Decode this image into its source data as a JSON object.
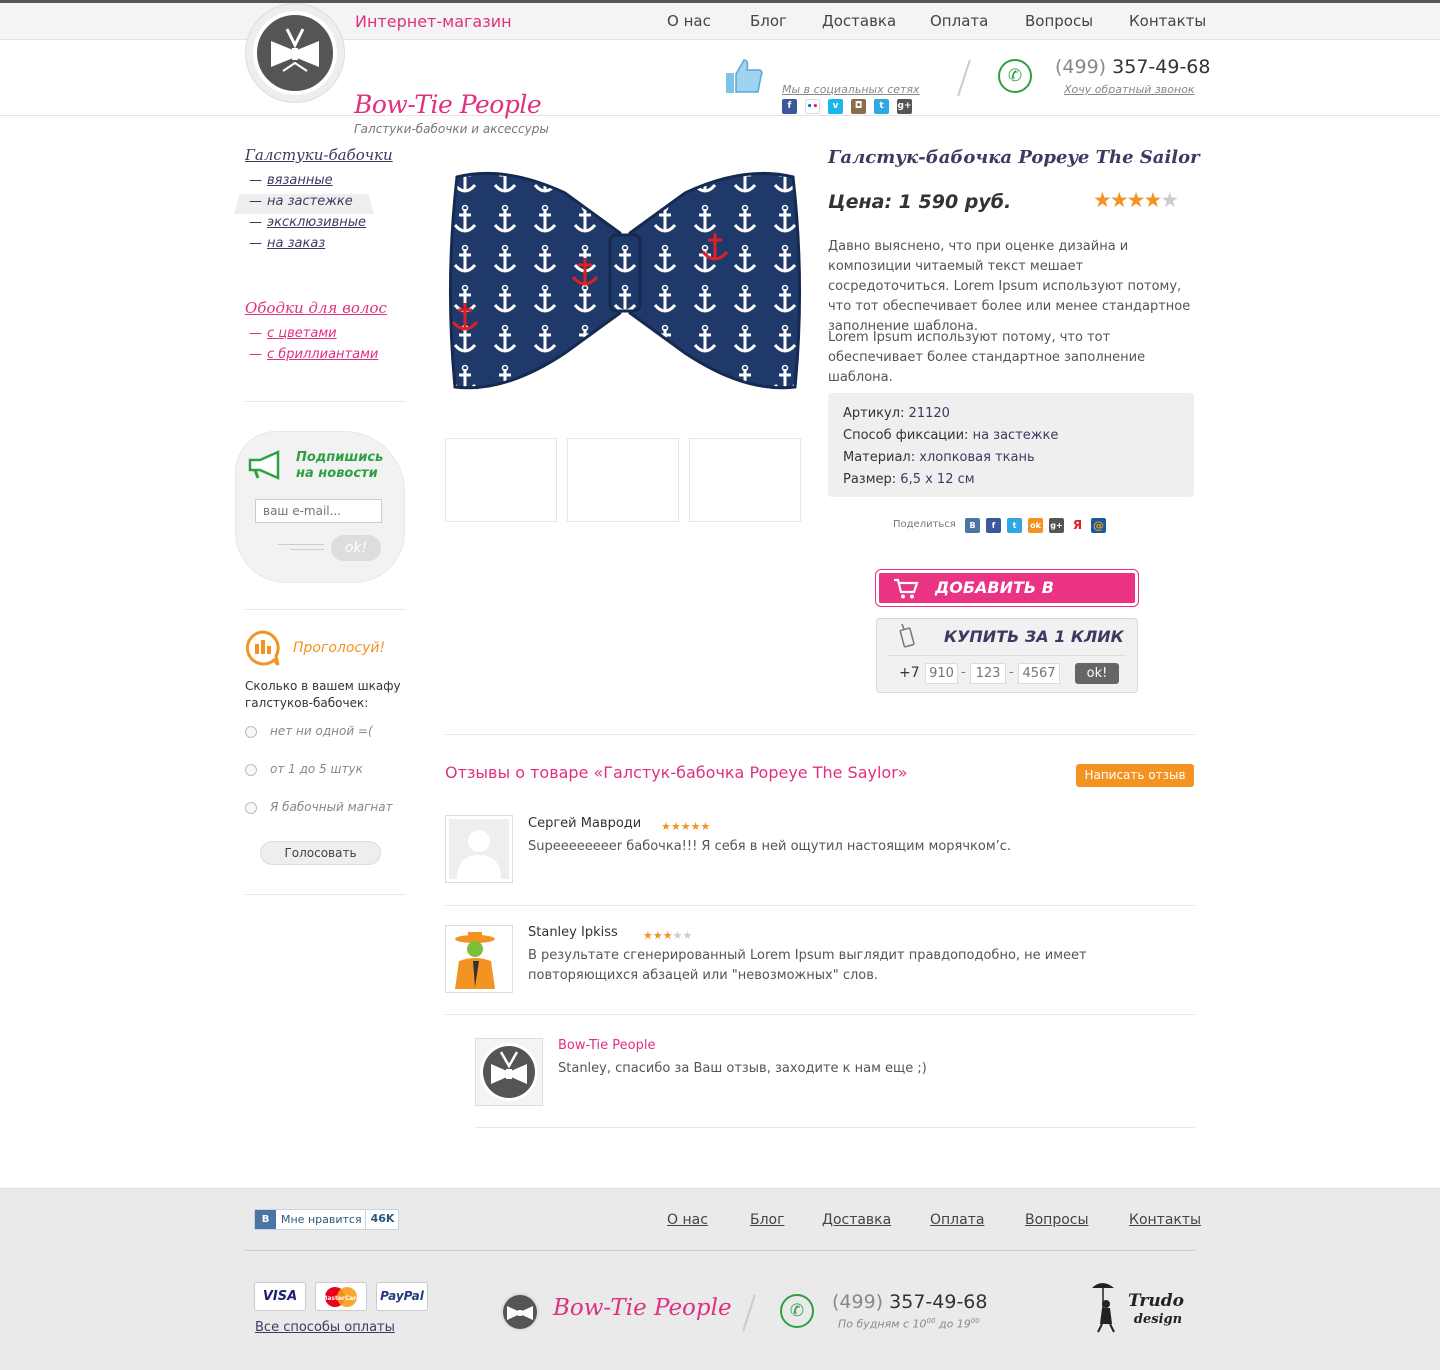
{
  "header": {
    "shop_label": "Интернет-магазин",
    "nav": [
      "О нас",
      "Блог",
      "Доставка",
      "Оплата",
      "Вопросы",
      "Контакты"
    ],
    "brand": "Bow-Tie People",
    "tagline": "Галстуки-бабочки и аксессуры",
    "social_caption": "Мы в социальных сетях",
    "social_icons": [
      "facebook-icon",
      "flickr-icon",
      "vimeo-icon",
      "instagram-icon",
      "twitter-icon",
      "googleplus-icon"
    ],
    "phone_code": "(499)",
    "phone_number": "357-49-68",
    "callback": "Хочу обратный звонок"
  },
  "sidebar": {
    "cat1_title": "Галстуки-бабочки",
    "cat1_items": [
      "вязанные",
      "на застежке",
      "эксклюзивные",
      "на заказ"
    ],
    "cat2_title": "Ободки для волос",
    "cat2_items": [
      "с цветами",
      "с бриллиантами"
    ],
    "subscribe_title_1": "Подпишись",
    "subscribe_title_2": "на новости",
    "email_placeholder": "ваш e-mail...",
    "subscribe_button": "ok!",
    "poll_title": "Проголосуй!",
    "poll_question": "Сколько в вашем шкафу галстуков-бабочек:",
    "poll_options": [
      "нет ни одной =(",
      "от 1 до 5 штук",
      "Я бабочный магнат"
    ],
    "vote_button": "Голосовать"
  },
  "product": {
    "title": "Галстук-бабочка Popeye The Sailor",
    "price": "Цена: 1 590 руб.",
    "rating": 4,
    "desc1": "Давно выяснено, что при оценке дизайна и композиции читаемый текст мешает сосредоточиться. Lorem Ipsum используют потому, что тот обеспечивает более или менее стандартное заполнение шаблона.",
    "desc2": "Lorem Ipsum используют потому, что тот обеспечивает более стандартное заполнение шаблона.",
    "specs": [
      {
        "label": "Артикул:",
        "value": "21120"
      },
      {
        "label": "Способ фиксации:",
        "value": "на застежке"
      },
      {
        "label": "Материал:",
        "value": "хлопковая ткань"
      },
      {
        "label": "Размер:",
        "value": "6,5 х 12 см"
      }
    ],
    "share_label": "Поделиться",
    "share_icons": [
      "vk-icon",
      "facebook-icon",
      "twitter-icon",
      "odnoklassniki-icon",
      "googleplus-icon",
      "ya-icon",
      "mail-icon"
    ],
    "cart_button": "ДОБАВИТЬ В КОРЗИНУ",
    "oneclick_title": "КУПИТЬ ЗА 1 КЛИК",
    "phone_prefix": "+7",
    "phone_ph1": "910",
    "phone_ph2": "123",
    "phone_ph3": "4567",
    "oneclick_button": "ok!"
  },
  "reviews": {
    "title": "Отзывы о товаре «Галстук-бабочка Popeye The Saylor»",
    "write_button": "Написать отзыв",
    "items": [
      {
        "name": "Сергей Мавроди",
        "rating": 5,
        "text": "Supeeeeeeeer бабочка!!! Я себя в ней ощутил настоящим морячком’с."
      },
      {
        "name": "Stanley Ipkiss",
        "rating": 3,
        "text": "В результате сгенерированный Lorem Ipsum выглядит правдоподобно, не имеет повторяющихся абзацей или \"невозможных\" слов."
      }
    ],
    "reply": {
      "name": "Bow-Tie People",
      "text": "Stanley, спасибо за Ваш отзыв, заходите к нам еще ;)"
    }
  },
  "footer": {
    "like_label": "Мне нравится",
    "like_count": "46K",
    "nav": [
      "О нас",
      "Блог",
      "Доставка",
      "Оплата",
      "Вопросы",
      "Контакты"
    ],
    "payments": [
      "VISA",
      "MasterCard",
      "PayPal"
    ],
    "all_payments": "Все способы оплаты",
    "brand": "Bow-Tie People",
    "phone_code": "(499)",
    "phone_number": "357-49-68",
    "hours_a": "По будням с 10",
    "hours_sup1": "00",
    "hours_b": " до 19",
    "hours_sup2": "00",
    "studio_1": "Trudo",
    "studio_2": "design"
  },
  "colors": {
    "accent": "#e03081",
    "dark": "#3d3a62",
    "orange": "#f39322",
    "green": "#2ea043"
  }
}
